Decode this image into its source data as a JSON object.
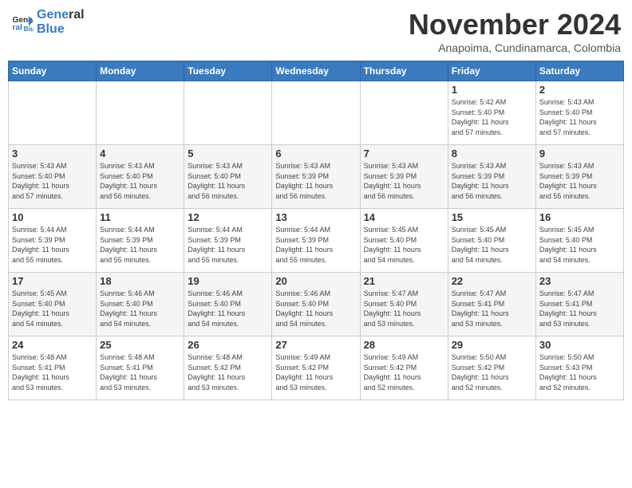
{
  "header": {
    "logo_line1": "General",
    "logo_line2": "Blue",
    "month": "November 2024",
    "location": "Anapoima, Cundinamarca, Colombia"
  },
  "weekdays": [
    "Sunday",
    "Monday",
    "Tuesday",
    "Wednesday",
    "Thursday",
    "Friday",
    "Saturday"
  ],
  "weeks": [
    [
      {
        "day": "",
        "info": ""
      },
      {
        "day": "",
        "info": ""
      },
      {
        "day": "",
        "info": ""
      },
      {
        "day": "",
        "info": ""
      },
      {
        "day": "",
        "info": ""
      },
      {
        "day": "1",
        "info": "Sunrise: 5:42 AM\nSunset: 5:40 PM\nDaylight: 11 hours\nand 57 minutes."
      },
      {
        "day": "2",
        "info": "Sunrise: 5:43 AM\nSunset: 5:40 PM\nDaylight: 11 hours\nand 57 minutes."
      }
    ],
    [
      {
        "day": "3",
        "info": "Sunrise: 5:43 AM\nSunset: 5:40 PM\nDaylight: 11 hours\nand 57 minutes."
      },
      {
        "day": "4",
        "info": "Sunrise: 5:43 AM\nSunset: 5:40 PM\nDaylight: 11 hours\nand 56 minutes."
      },
      {
        "day": "5",
        "info": "Sunrise: 5:43 AM\nSunset: 5:40 PM\nDaylight: 11 hours\nand 56 minutes."
      },
      {
        "day": "6",
        "info": "Sunrise: 5:43 AM\nSunset: 5:39 PM\nDaylight: 11 hours\nand 56 minutes."
      },
      {
        "day": "7",
        "info": "Sunrise: 5:43 AM\nSunset: 5:39 PM\nDaylight: 11 hours\nand 56 minutes."
      },
      {
        "day": "8",
        "info": "Sunrise: 5:43 AM\nSunset: 5:39 PM\nDaylight: 11 hours\nand 56 minutes."
      },
      {
        "day": "9",
        "info": "Sunrise: 5:43 AM\nSunset: 5:39 PM\nDaylight: 11 hours\nand 55 minutes."
      }
    ],
    [
      {
        "day": "10",
        "info": "Sunrise: 5:44 AM\nSunset: 5:39 PM\nDaylight: 11 hours\nand 55 minutes."
      },
      {
        "day": "11",
        "info": "Sunrise: 5:44 AM\nSunset: 5:39 PM\nDaylight: 11 hours\nand 55 minutes."
      },
      {
        "day": "12",
        "info": "Sunrise: 5:44 AM\nSunset: 5:39 PM\nDaylight: 11 hours\nand 55 minutes."
      },
      {
        "day": "13",
        "info": "Sunrise: 5:44 AM\nSunset: 5:39 PM\nDaylight: 11 hours\nand 55 minutes."
      },
      {
        "day": "14",
        "info": "Sunrise: 5:45 AM\nSunset: 5:40 PM\nDaylight: 11 hours\nand 54 minutes."
      },
      {
        "day": "15",
        "info": "Sunrise: 5:45 AM\nSunset: 5:40 PM\nDaylight: 11 hours\nand 54 minutes."
      },
      {
        "day": "16",
        "info": "Sunrise: 5:45 AM\nSunset: 5:40 PM\nDaylight: 11 hours\nand 54 minutes."
      }
    ],
    [
      {
        "day": "17",
        "info": "Sunrise: 5:45 AM\nSunset: 5:40 PM\nDaylight: 11 hours\nand 54 minutes."
      },
      {
        "day": "18",
        "info": "Sunrise: 5:46 AM\nSunset: 5:40 PM\nDaylight: 11 hours\nand 54 minutes."
      },
      {
        "day": "19",
        "info": "Sunrise: 5:46 AM\nSunset: 5:40 PM\nDaylight: 11 hours\nand 54 minutes."
      },
      {
        "day": "20",
        "info": "Sunrise: 5:46 AM\nSunset: 5:40 PM\nDaylight: 11 hours\nand 54 minutes."
      },
      {
        "day": "21",
        "info": "Sunrise: 5:47 AM\nSunset: 5:40 PM\nDaylight: 11 hours\nand 53 minutes."
      },
      {
        "day": "22",
        "info": "Sunrise: 5:47 AM\nSunset: 5:41 PM\nDaylight: 11 hours\nand 53 minutes."
      },
      {
        "day": "23",
        "info": "Sunrise: 5:47 AM\nSunset: 5:41 PM\nDaylight: 11 hours\nand 53 minutes."
      }
    ],
    [
      {
        "day": "24",
        "info": "Sunrise: 5:48 AM\nSunset: 5:41 PM\nDaylight: 11 hours\nand 53 minutes."
      },
      {
        "day": "25",
        "info": "Sunrise: 5:48 AM\nSunset: 5:41 PM\nDaylight: 11 hours\nand 53 minutes."
      },
      {
        "day": "26",
        "info": "Sunrise: 5:48 AM\nSunset: 5:42 PM\nDaylight: 11 hours\nand 53 minutes."
      },
      {
        "day": "27",
        "info": "Sunrise: 5:49 AM\nSunset: 5:42 PM\nDaylight: 11 hours\nand 53 minutes."
      },
      {
        "day": "28",
        "info": "Sunrise: 5:49 AM\nSunset: 5:42 PM\nDaylight: 11 hours\nand 52 minutes."
      },
      {
        "day": "29",
        "info": "Sunrise: 5:50 AM\nSunset: 5:42 PM\nDaylight: 11 hours\nand 52 minutes."
      },
      {
        "day": "30",
        "info": "Sunrise: 5:50 AM\nSunset: 5:43 PM\nDaylight: 11 hours\nand 52 minutes."
      }
    ]
  ]
}
